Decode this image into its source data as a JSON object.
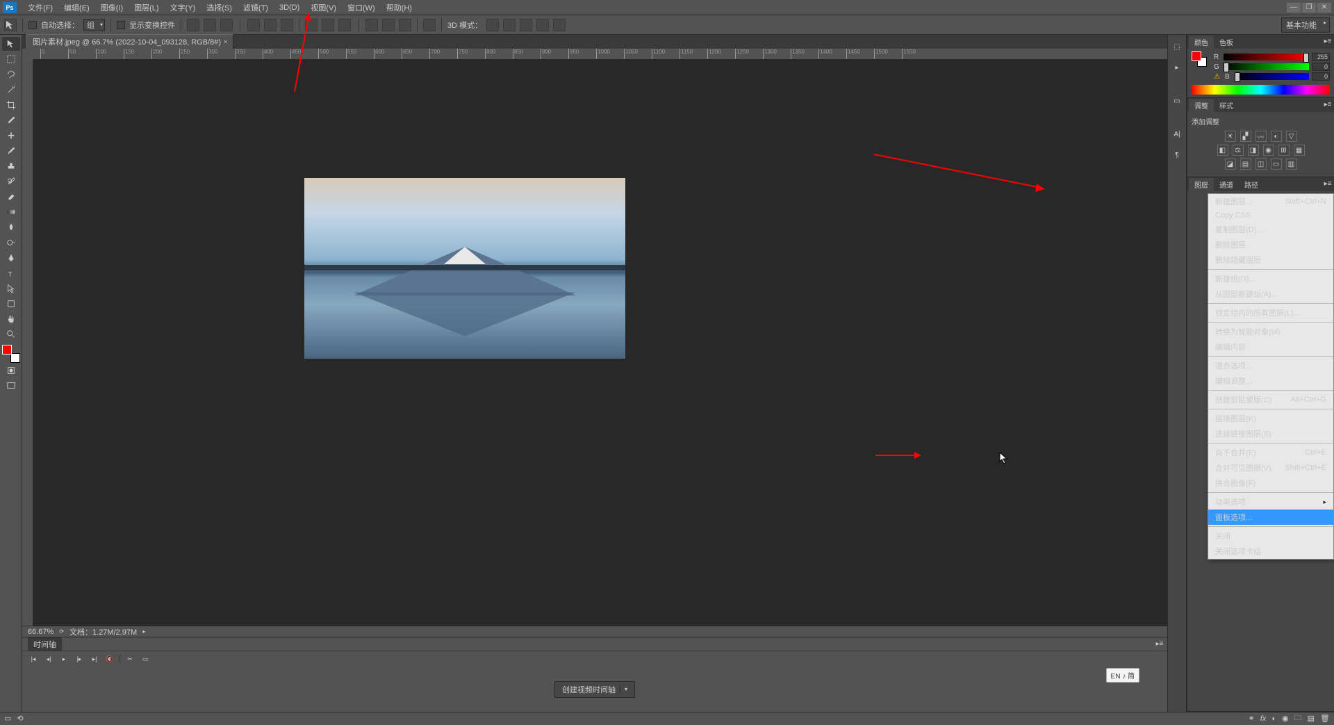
{
  "app_logo": "Ps",
  "menubar": [
    "文件(F)",
    "编辑(E)",
    "图像(I)",
    "图层(L)",
    "文字(Y)",
    "选择(S)",
    "滤镜(T)",
    "3D(D)",
    "视图(V)",
    "窗口(W)",
    "帮助(H)"
  ],
  "window_controls": {
    "min": "—",
    "max": "❐",
    "close": "✕"
  },
  "options": {
    "auto_select": "自动选择：",
    "auto_select_val": "组",
    "show_transform": "显示变换控件",
    "mode_3d": "3D 模式：",
    "workspace": "基本功能"
  },
  "document": {
    "tab_title": "图片素材.jpeg @ 66.7% (2022-10-04_093128, RGB/8#)",
    "zoom": "66.67%",
    "filesize": "文档：1.27M/2.97M"
  },
  "ruler_h": [
    0,
    50,
    100,
    150,
    200,
    250,
    300,
    350,
    400,
    450,
    500,
    550,
    600,
    650,
    700,
    750,
    800,
    850,
    900,
    950,
    1000,
    1050,
    1100,
    1150,
    1200,
    1250,
    1300,
    1350,
    1400,
    1450,
    1500,
    1550
  ],
  "timeline": {
    "tab": "时间轴",
    "create_btn": "创建视频时间轴"
  },
  "panels": {
    "color_tab": "颜色",
    "swatches_tab": "色板",
    "r": "R",
    "g": "G",
    "b": "B",
    "r_val": "255",
    "g_val": "0",
    "b_val": "0",
    "adjust_tab": "调整",
    "styles_tab": "样式",
    "adjust_label": "添加调整",
    "layers_tab": "图层",
    "channels_tab": "通道",
    "paths_tab": "路径"
  },
  "context_menu": [
    {
      "t": "新建图层...",
      "s": "Shift+Ctrl+N",
      "dis": false
    },
    {
      "t": "Copy CSS",
      "dis": true
    },
    {
      "t": "复制图层(D)...",
      "dis": false
    },
    {
      "t": "删除图层",
      "dis": false
    },
    {
      "t": "删除隐藏图层",
      "dis": true
    },
    {
      "sep": true
    },
    {
      "t": "新建组(G)...",
      "dis": false
    },
    {
      "t": "从图层新建组(A)...",
      "dis": false
    },
    {
      "sep": true
    },
    {
      "t": "锁定组内的所有图层(L)...",
      "dis": true
    },
    {
      "sep": true
    },
    {
      "t": "转换为智能对象(M)",
      "dis": false
    },
    {
      "t": "编辑内容",
      "dis": false
    },
    {
      "sep": true
    },
    {
      "t": "混合选项...",
      "dis": false
    },
    {
      "t": "编辑调整...",
      "dis": true
    },
    {
      "sep": true
    },
    {
      "t": "创建剪贴蒙版(C)",
      "s": "Alt+Ctrl+G",
      "dis": false
    },
    {
      "sep": true
    },
    {
      "t": "链接图层(K)",
      "dis": true
    },
    {
      "t": "选择链接图层(S)",
      "dis": true
    },
    {
      "sep": true
    },
    {
      "t": "向下合并(E)",
      "s": "Ctrl+E",
      "dis": false
    },
    {
      "t": "合并可见图层(V)",
      "s": "Shift+Ctrl+E",
      "dis": false
    },
    {
      "t": "拼合图像(F)",
      "dis": false
    },
    {
      "sep": true
    },
    {
      "t": "动画选项",
      "sub": true,
      "dis": false
    },
    {
      "t": "面板选项...",
      "sel": true,
      "dis": false
    },
    {
      "sep": true
    },
    {
      "t": "关闭",
      "dis": false
    },
    {
      "t": "关闭选项卡组",
      "dis": false
    }
  ],
  "ime": "EN ♪ 简"
}
